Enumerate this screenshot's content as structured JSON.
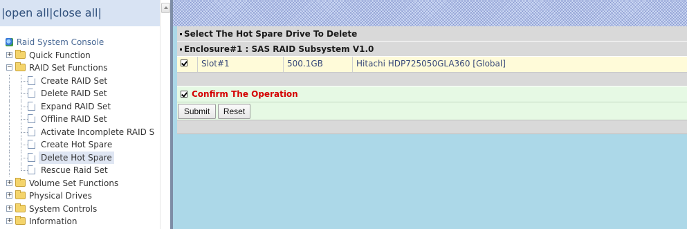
{
  "nav": {
    "open_all": "open all",
    "close_all": "close all",
    "sep1": "|",
    "sep2": "|",
    "sep3": "|",
    "root_label": "Raid System Console",
    "items": [
      {
        "label": "Quick Function",
        "expanded": false
      },
      {
        "label": "RAID Set Functions",
        "expanded": true,
        "children": [
          "Create RAID Set",
          "Delete RAID Set",
          "Expand RAID Set",
          "Offline RAID Set",
          "Activate Incomplete RAID S",
          "Create Hot Spare",
          "Delete Hot Spare",
          "Rescue Raid Set"
        ]
      },
      {
        "label": "Volume Set Functions",
        "expanded": false
      },
      {
        "label": "Physical Drives",
        "expanded": false
      },
      {
        "label": "System Controls",
        "expanded": false
      },
      {
        "label": "Information",
        "expanded": false
      }
    ],
    "selected": "Delete Hot Spare"
  },
  "main": {
    "title": "Select The Hot Spare Drive To Delete",
    "enclosure": "Enclosure#1 : SAS RAID Subsystem V1.0",
    "drive": {
      "checked": true,
      "slot": "Slot#1",
      "capacity": "500.1GB",
      "model": "Hitachi HDP725050GLA360 [Global]"
    },
    "confirm_checked": true,
    "confirm_label": "Confirm The Operation",
    "submit_label": "Submit",
    "reset_label": "Reset"
  },
  "colors": {
    "nav_header_bg": "#d8e3f3",
    "content_bg": "#acd8e8",
    "confirm_text": "#d40000",
    "drive_row_bg": "#fffbd9",
    "confirm_row_bg": "#e6f9e4"
  }
}
